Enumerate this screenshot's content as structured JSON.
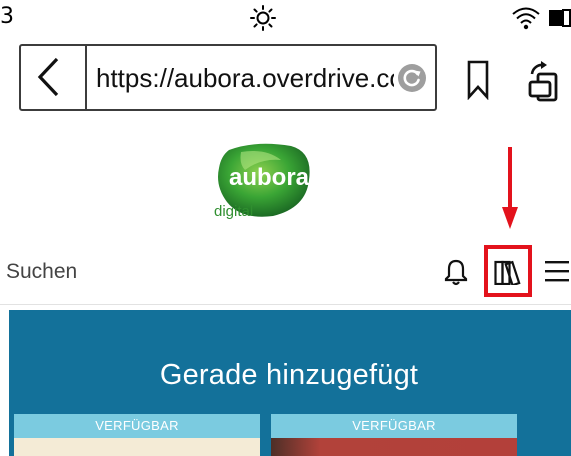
{
  "status_bar": {
    "left_text": "3"
  },
  "browser": {
    "url": "https://aubora.overdrive.com/"
  },
  "logo": {
    "main": "aubora",
    "sub": "digital"
  },
  "nav": {
    "search_placeholder": "Suchen"
  },
  "hero": {
    "title": "Gerade hinzugefügt",
    "books": [
      {
        "status": "VERFÜGBAR"
      },
      {
        "status": "VERFÜGBAR"
      }
    ]
  },
  "colors": {
    "accent_blue": "#13719a",
    "badge_blue": "#7bcbe0",
    "annotation_red": "#e3121c",
    "logo_green": "#4caf2a"
  }
}
